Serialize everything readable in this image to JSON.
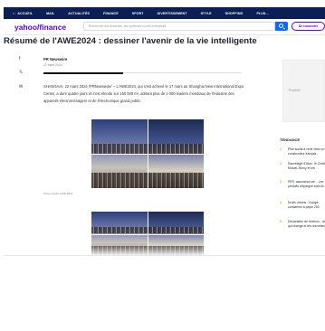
{
  "nav": {
    "items": [
      "ACCUEIL",
      "MAIL",
      "ACTUALITÉS",
      "FINANCE",
      "SPORT",
      "DIVERTISSEMENT",
      "STYLE",
      "SHOPPING",
      "PLUS..."
    ]
  },
  "header": {
    "logo_brand": "yahoo",
    "logo_slash": "/",
    "logo_product": "finance",
    "search_placeholder": "Rechercher des actualités, des symboles ou des entreprises",
    "signin_label": "Se connecter"
  },
  "article": {
    "title": "Résumé de l'AWE2024 : dessiner l'avenir de la vie intelligente",
    "author": "PR Newswire",
    "date": "22 mars 2024",
    "body": "SHANGHAI, 22 mars 2024 /PRNewswire/ -- L'AWE2024, qui s'est achevé le 17 mars au Shanghai New International Expo Center, a duré quatre jours et s'est étendu sur 150 000 m², attirant plus de 1 000 leaders mondiaux de l'industrie des appareils électroménagers et de l'électronique grand public.",
    "caption": "Photo Credit: AWE 2024"
  },
  "sidebar": {
    "ad_label": "Publicité",
    "trending_title": "TENDANCE",
    "trending": [
      {
        "num": "1",
        "text": "Plan social à venir chez un constructeur français"
      },
      {
        "num": "2",
        "text": "Sauvetage d'Atos : le Crédit Mutuel, Bercy et les créanciers réduire la dette"
      },
      {
        "num": "3",
        "text": "PER, assurance-vie... Les produits d'épargne sont-ils encore rentables cette année ?"
      },
      {
        "num": "4",
        "text": "Droits voisins : Google condamné à payer 250 millions d'euros à la France"
      },
      {
        "num": "5",
        "text": "Déclaration de revenus : ce qui change et les nouvelles pour ces contribuables"
      }
    ]
  },
  "colors": {
    "nav_bg": "#0b1f56",
    "brand": "#6001d2",
    "search_button": "#0f69ff",
    "trending_number": "#eba41a"
  }
}
